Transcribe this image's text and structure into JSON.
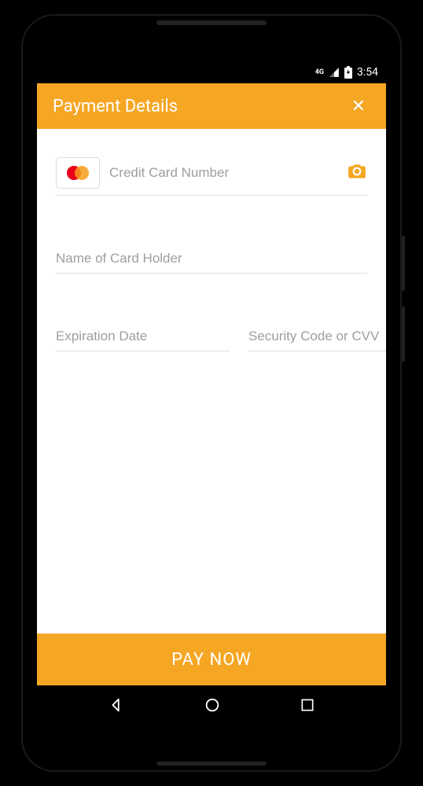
{
  "status": {
    "network": "4G",
    "time": "3:54"
  },
  "appbar": {
    "title": "Payment Details"
  },
  "form": {
    "card_number_placeholder": "Credit Card Number",
    "card_holder_placeholder": "Name of Card Holder",
    "expiration_placeholder": "Expiration Date",
    "cvv_placeholder": "Security Code or CVV"
  },
  "actions": {
    "pay_label": "PAY NOW"
  },
  "colors": {
    "accent": "#F5A623"
  }
}
